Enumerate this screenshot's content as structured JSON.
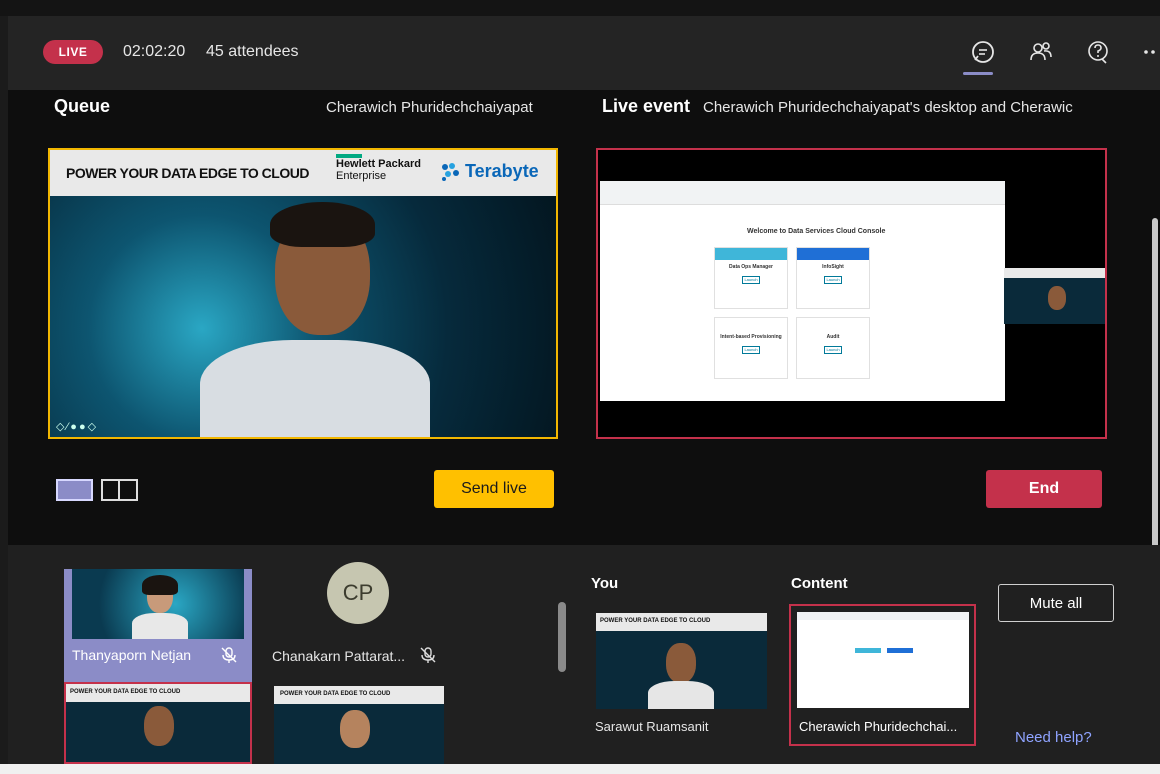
{
  "header": {
    "live_label": "LIVE",
    "timer": "02:02:20",
    "attendees": "45 attendees",
    "icons": [
      "chat-icon",
      "people-icon",
      "help-icon",
      "more-icon"
    ]
  },
  "queue": {
    "title": "Queue",
    "presenter": "Cherawich Phuridechchaiyapat",
    "send_live_label": "Send live"
  },
  "live_event": {
    "title": "Live event",
    "presenter": "Cherawich Phuridechchaiyapat's desktop and Cherawic",
    "end_label": "End"
  },
  "video_banner": {
    "headline": "POWER YOUR DATA EDGE TO CLOUD",
    "hpe_line1": "Hewlett Packard",
    "hpe_line2": "Enterprise",
    "brand": "Terabyte"
  },
  "shared_desktop": {
    "welcome": "Welcome to Data Services Cloud Console",
    "cards": [
      {
        "title": "Data Ops Manager",
        "button": "Launch"
      },
      {
        "title": "InfoSight",
        "button": "Launch"
      },
      {
        "title": "Intent-based Provisioning",
        "button": "Launch"
      },
      {
        "title": "Audit",
        "button": "Launch"
      }
    ]
  },
  "participants": [
    {
      "name": "Thanyaporn Netjan",
      "muted": true
    },
    {
      "name": "Chanakarn Pattarat...",
      "initials": "CP",
      "muted": true
    }
  ],
  "you": {
    "title": "You",
    "name": "Sarawut Ruamsanit"
  },
  "content": {
    "title": "Content",
    "name": "Cherawich Phuridechchai..."
  },
  "mute_all_label": "Mute all",
  "need_help_label": "Need help?",
  "colors": {
    "live": "#c4314b",
    "queue_border": "#f2b701",
    "send_live": "#ffc000",
    "accent": "#8b8cc7",
    "link": "#8fa3ff"
  }
}
